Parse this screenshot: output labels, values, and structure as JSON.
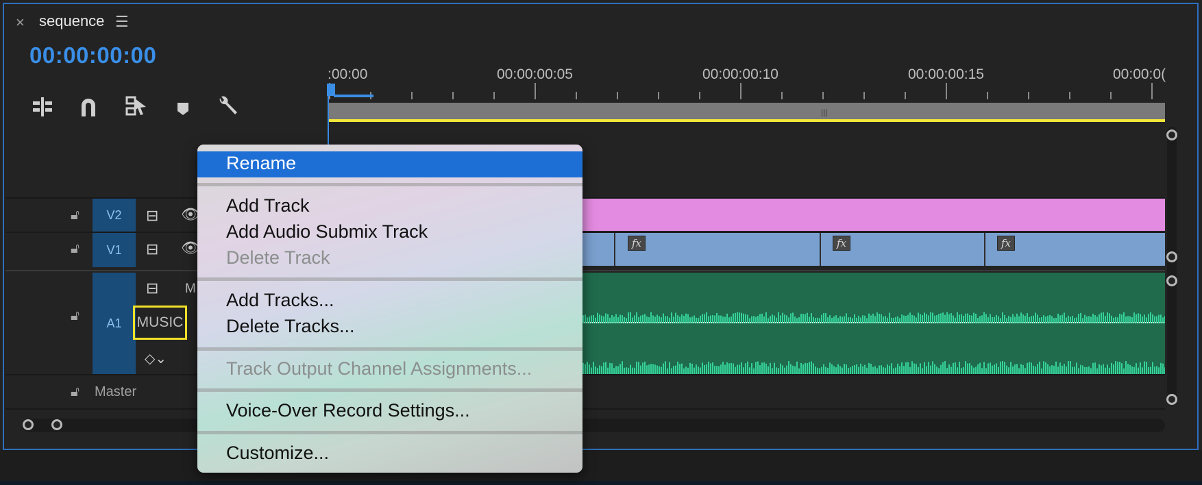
{
  "panel": {
    "tab_title": "sequence",
    "close_glyph": "×",
    "menu_glyph": "☰",
    "timecode": "00:00:00:00"
  },
  "ruler": {
    "labels": [
      ":00:00",
      "00:00:00:05",
      "00:00:00:10",
      "00:00:00:15",
      "00:00:0("
    ]
  },
  "toolbar": {
    "icons": [
      "insert-sequence-nest-icon",
      "snap-magnet-icon",
      "linked-selection-icon",
      "add-marker-icon",
      "timeline-settings-wrench-icon"
    ]
  },
  "tracks": {
    "v2": {
      "label": "V2"
    },
    "v1": {
      "label": "V1"
    },
    "a1": {
      "label": "A1",
      "name": "MUSIC",
      "mute_partial": "M"
    },
    "master": {
      "label": "Master"
    }
  },
  "clips": {
    "fx_label": "fx",
    "v2_color": "#e38be0",
    "v1_color": "#7aa0cf",
    "audio_color": "#1f6b4c",
    "waveform_color": "#36d199"
  },
  "context_menu": {
    "items": [
      {
        "label": "Rename",
        "enabled": true,
        "highlighted": true
      },
      {
        "label": "Add Track",
        "enabled": true
      },
      {
        "label": "Add Audio Submix Track",
        "enabled": true
      },
      {
        "label": "Delete Track",
        "enabled": false
      },
      {
        "label": "Add Tracks...",
        "enabled": true
      },
      {
        "label": "Delete Tracks...",
        "enabled": true
      },
      {
        "label": "Track Output Channel Assignments...",
        "enabled": false
      },
      {
        "label": "Voice-Over Record Settings...",
        "enabled": true
      },
      {
        "label": "Customize...",
        "enabled": true
      }
    ]
  },
  "colors": {
    "accent": "#3a8ee6",
    "highlight": "#1d6fd6",
    "track_label_bg": "#1a4c7a",
    "name_outline": "#f3e22a"
  }
}
